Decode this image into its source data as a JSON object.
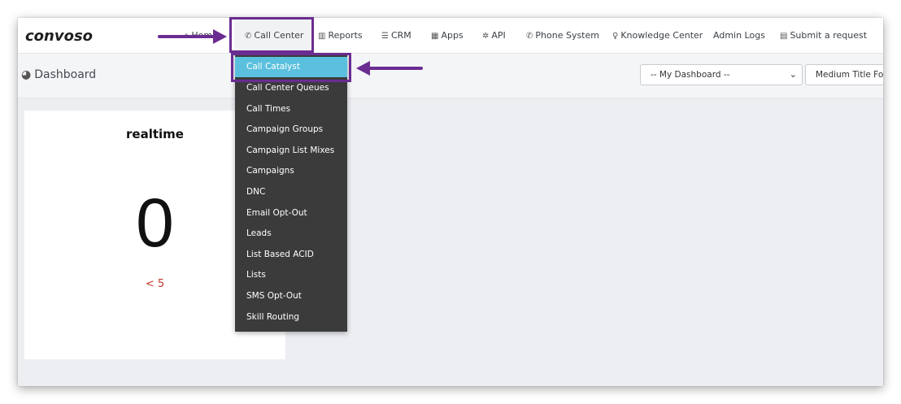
{
  "app": {
    "logo": "convoso"
  },
  "nav": {
    "items": [
      {
        "label": "Home",
        "icon": "home-icon",
        "glyph": "⌂"
      },
      {
        "label": "Call Center",
        "icon": "phone-icon",
        "glyph": "✆"
      },
      {
        "label": "Reports",
        "icon": "bar-chart-icon",
        "glyph": "▥"
      },
      {
        "label": "CRM",
        "icon": "list-icon",
        "glyph": "☰"
      },
      {
        "label": "Apps",
        "icon": "grid-icon",
        "glyph": "▦"
      },
      {
        "label": "API",
        "icon": "gear-icon",
        "glyph": "✲"
      },
      {
        "label": "Phone System",
        "icon": "phone-icon",
        "glyph": "✆"
      },
      {
        "label": "Knowledge Center",
        "icon": "lightbulb-icon",
        "glyph": "♀"
      },
      {
        "label": "Admin Logs",
        "icon": "",
        "glyph": ""
      },
      {
        "label": "Submit a request",
        "icon": "ticket-icon",
        "glyph": "▤"
      }
    ]
  },
  "subbar": {
    "title": "Dashboard",
    "title_glyph": "◕",
    "dashboard_select": "-- My Dashboard --",
    "font_select": "Medium Title Font"
  },
  "widget": {
    "title": "realtime",
    "value": "0",
    "sub": "< 5"
  },
  "dropdown": {
    "items": [
      "Call Catalyst",
      "Call Center Queues",
      "Call Times",
      "Campaign Groups",
      "Campaign List Mixes",
      "Campaigns",
      "DNC",
      "Email Opt-Out",
      "Leads",
      "List Based ACID",
      "Lists",
      "SMS Opt-Out",
      "Skill Routing"
    ],
    "selected": "Call Catalyst"
  },
  "colors": {
    "accent": "#5bc0de",
    "callout": "#6a2c91",
    "dropdown_bg": "#3b3b3b",
    "alert_text": "#c0392b"
  }
}
